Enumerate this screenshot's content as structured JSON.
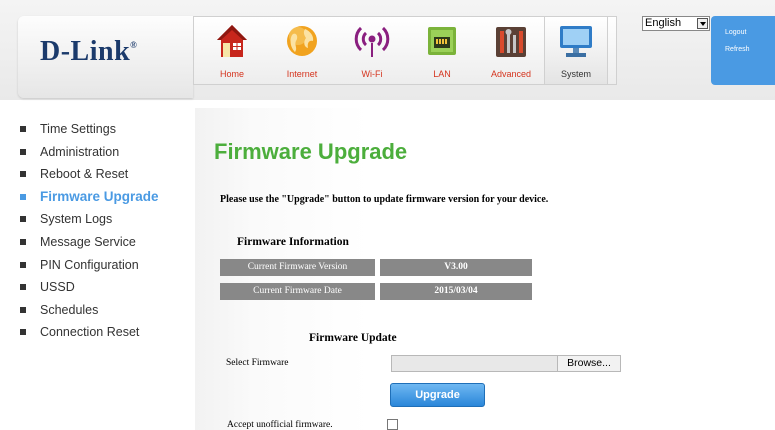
{
  "brand": {
    "name": "D-Link",
    "mark": "®"
  },
  "nav": {
    "items": [
      {
        "label": "Home",
        "icon": "home-icon"
      },
      {
        "label": "Internet",
        "icon": "globe-icon"
      },
      {
        "label": "Wi-Fi",
        "icon": "wifi-icon"
      },
      {
        "label": "LAN",
        "icon": "lan-icon"
      },
      {
        "label": "Advanced",
        "icon": "tools-icon"
      },
      {
        "label": "System",
        "icon": "computer-icon"
      }
    ],
    "active": "System"
  },
  "language": {
    "selected": "English"
  },
  "account": {
    "logout": "Logout",
    "refresh": "Refresh"
  },
  "sidebar": {
    "items": [
      {
        "label": "Time Settings"
      },
      {
        "label": "Administration"
      },
      {
        "label": "Reboot & Reset"
      },
      {
        "label": "Firmware Upgrade"
      },
      {
        "label": "System Logs"
      },
      {
        "label": "Message Service"
      },
      {
        "label": "PIN Configuration"
      },
      {
        "label": "USSD"
      },
      {
        "label": "Schedules"
      },
      {
        "label": "Connection Reset"
      }
    ],
    "active": "Firmware Upgrade"
  },
  "page": {
    "title": "Firmware Upgrade",
    "instruction": "Please use the \"Upgrade\" button to update firmware version for your device.",
    "info": {
      "heading": "Firmware Information",
      "rows": [
        {
          "label": "Current Firmware Version",
          "value": "V3.00"
        },
        {
          "label": "Current Firmware Date",
          "value": "2015/03/04"
        }
      ]
    },
    "update": {
      "heading": "Firmware Update",
      "select_label": "Select Firmware",
      "browse_label": "Browse...",
      "upgrade_label": "Upgrade",
      "unofficial_label": "Accept unofficial firmware.",
      "unofficial_checked": false
    }
  },
  "colors": {
    "accent_blue": "#4a9ae3",
    "title_green": "#4cae3c",
    "nav_label_red": "#d5341e",
    "brand_navy": "#1b3a6b",
    "info_cell_gray": "#888888"
  }
}
